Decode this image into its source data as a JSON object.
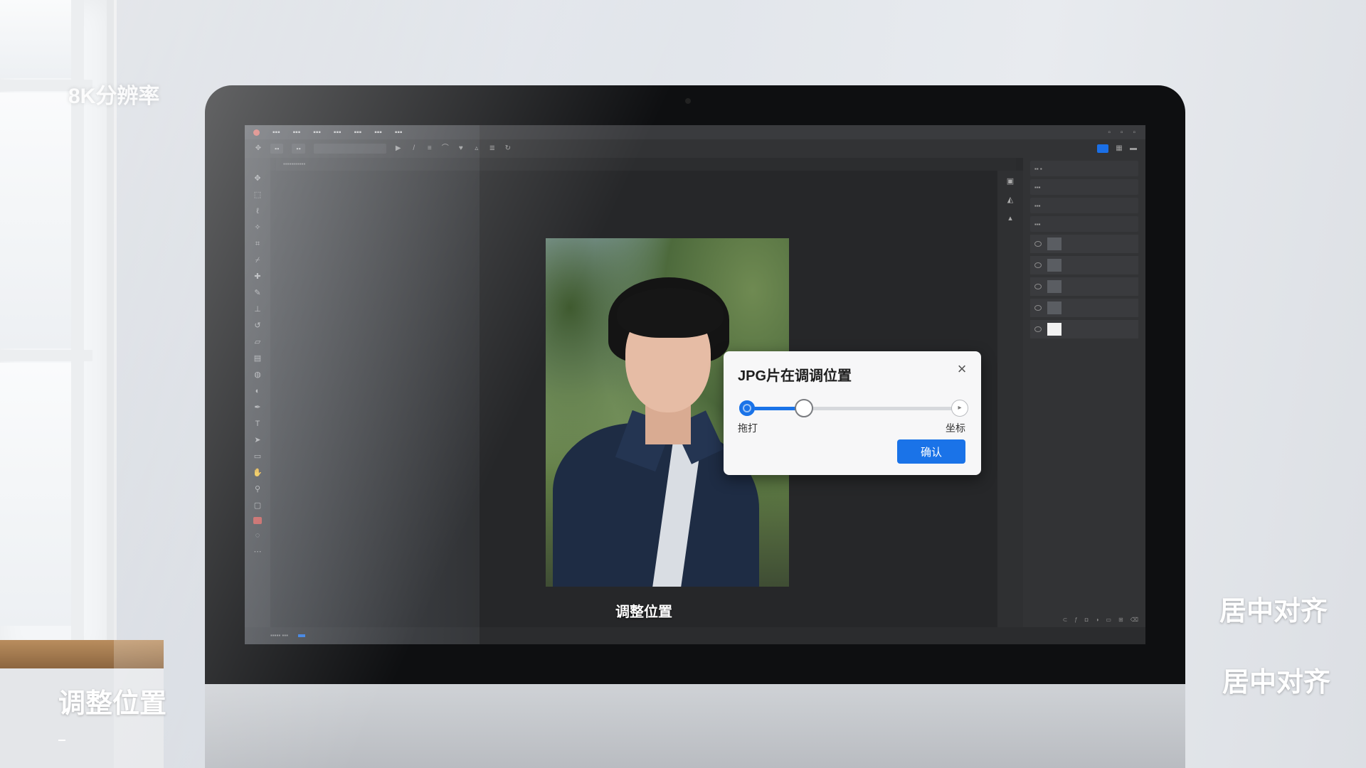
{
  "overlay": {
    "top_left": "8K分辨率",
    "bottom_left": "调整位置",
    "right_top": "居中对齐",
    "right_bottom": "居中对齐",
    "screen_caption": "调整位置"
  },
  "dialog": {
    "title": "JPG片在调调位置",
    "label_left": "拖打",
    "label_right": "坐标",
    "button": "确认",
    "slider_value_percent": 28,
    "start_icon": "0",
    "end_icon": "▸"
  },
  "colors": {
    "accent": "#1a73e8",
    "close_dot": "#e05a4f"
  },
  "icons": [
    "close-icon",
    "move-icon",
    "lasso-icon",
    "crop-icon",
    "brush-icon",
    "eraser-icon",
    "text-icon",
    "eye-icon",
    "layer-thumb-icon"
  ]
}
